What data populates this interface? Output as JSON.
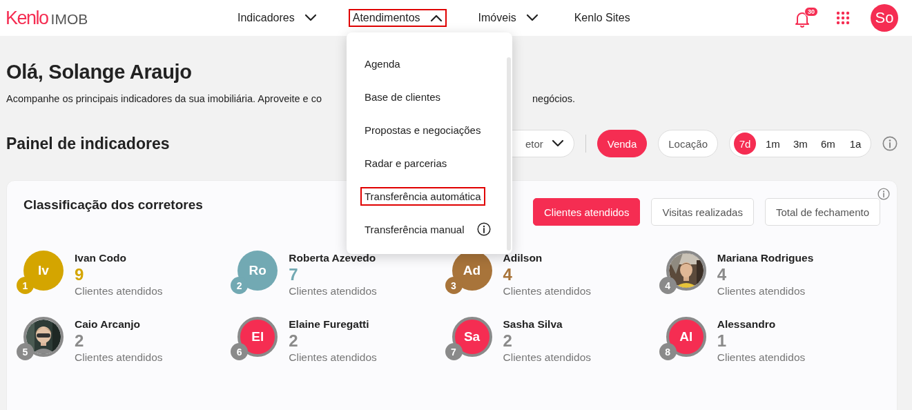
{
  "header": {
    "logo_brand": "Kenlo",
    "logo_product": "IMOB",
    "nav": [
      {
        "label": "Indicadores",
        "expanded": false,
        "highlighted": false
      },
      {
        "label": "Atendimentos",
        "expanded": true,
        "highlighted": true
      },
      {
        "label": "Imóveis",
        "expanded": false,
        "highlighted": false
      },
      {
        "label": "Kenlo Sites",
        "highlighted": false
      }
    ],
    "notifications": "30",
    "avatar": "So"
  },
  "menu": {
    "items": [
      {
        "label": "Agenda",
        "highlighted": false,
        "kind": "plain"
      },
      {
        "label": "Base de clientes",
        "highlighted": false,
        "kind": "plain"
      },
      {
        "label": "Propostas e negociações",
        "highlighted": false,
        "kind": "plain"
      },
      {
        "label": "Radar e parcerias",
        "highlighted": false,
        "kind": "plain"
      },
      {
        "label": "Transferência automática",
        "highlighted": true,
        "kind": "plain"
      },
      {
        "label": "Transferência manual",
        "highlighted": false,
        "kind": "info"
      }
    ]
  },
  "greeting": "Olá, Solange Araujo",
  "subtitle": [
    "Acompanhe os principais indicadores da sua imobiliária. Aproveite e co",
    "negócios."
  ],
  "panel": {
    "title": "Painel de indicadores",
    "filter": "etor",
    "business": [
      {
        "label": "Venda",
        "selected": true
      },
      {
        "label": "Locação",
        "selected": false
      }
    ],
    "periods": [
      {
        "label": "7d",
        "selected": true
      },
      {
        "label": "1m",
        "selected": false
      },
      {
        "label": "3m",
        "selected": false
      },
      {
        "label": "6m",
        "selected": false
      },
      {
        "label": "1a",
        "selected": false
      }
    ]
  },
  "ranking": {
    "title": "Classificação dos corretores",
    "metrics": [
      {
        "label": "Clientes atendidos",
        "selected": true
      },
      {
        "label": "Visitas realizadas",
        "selected": false
      },
      {
        "label": "Total de fechamento",
        "selected": false
      }
    ],
    "brokers": [
      {
        "rank": "1",
        "name": "Ivan Codo",
        "value": "9",
        "caption": "Clientes atendidos",
        "kind": "initials",
        "initials": "Iv",
        "color": "#d4a500",
        "podium": true
      },
      {
        "rank": "2",
        "name": "Roberta Azevedo",
        "value": "7",
        "caption": "Clientes atendidos",
        "kind": "initials",
        "initials": "Ro",
        "color": "#72a9b3",
        "podium": true
      },
      {
        "rank": "3",
        "name": "Adilson",
        "value": "4",
        "caption": "Clientes atendidos",
        "kind": "initials",
        "initials": "Ad",
        "color": "#a8743a",
        "podium": true
      },
      {
        "rank": "4",
        "name": "Mariana Rodrigues",
        "value": "4",
        "caption": "Clientes atendidos",
        "kind": "picture",
        "podium": false
      },
      {
        "rank": "5",
        "name": "Caio Arcanjo",
        "value": "2",
        "caption": "Clientes atendidos",
        "kind": "picture",
        "podium": false
      },
      {
        "rank": "6",
        "name": "Elaine Furegatti",
        "value": "2",
        "caption": "Clientes atendidos",
        "kind": "initials",
        "initials": "El",
        "color": "#f52d52",
        "podium": false
      },
      {
        "rank": "7",
        "name": "Sasha Silva",
        "value": "2",
        "caption": "Clientes atendidos",
        "kind": "initials",
        "initials": "Sa",
        "color": "#f52d52",
        "podium": false
      },
      {
        "rank": "8",
        "name": "Alessandro",
        "value": "1",
        "caption": "Clientes atendidos",
        "kind": "initials",
        "initials": "Al",
        "color": "#f52d52",
        "podium": false
      }
    ]
  }
}
